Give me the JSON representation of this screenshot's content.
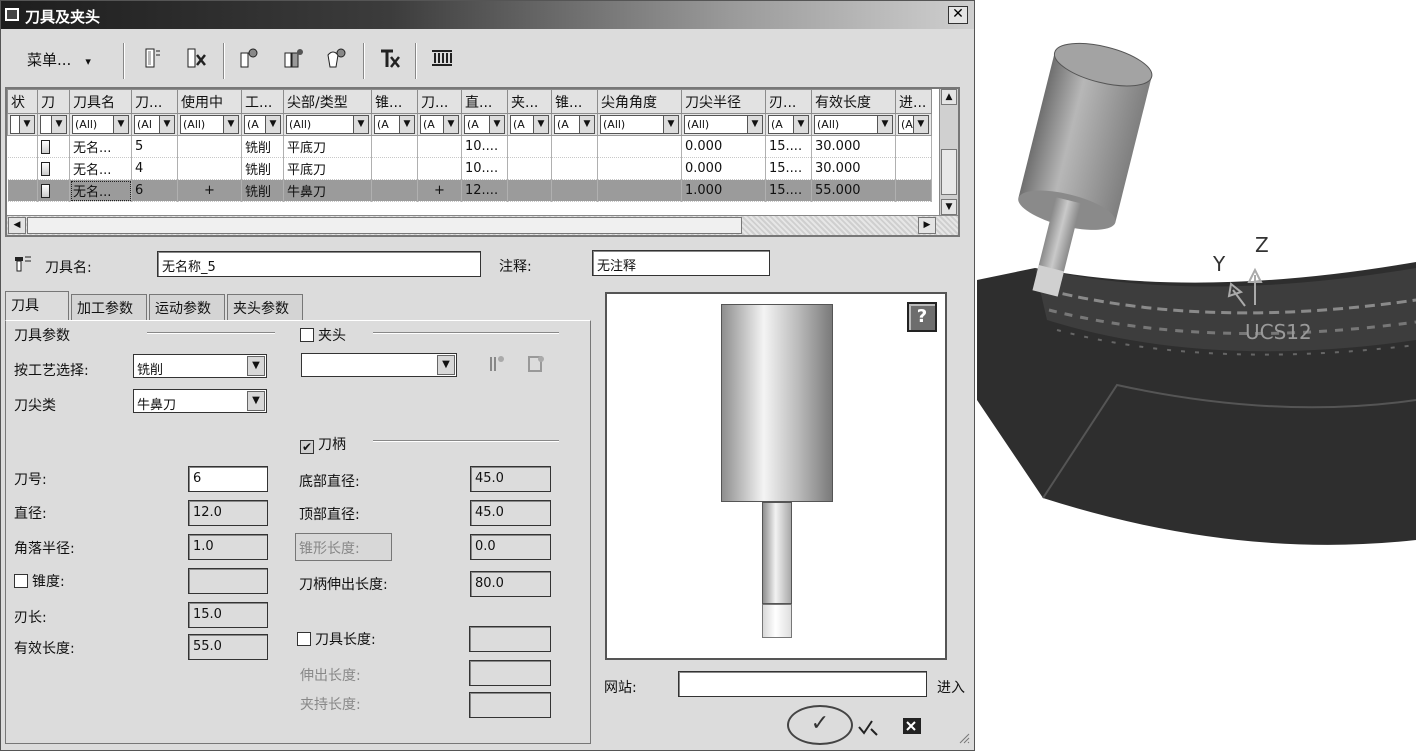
{
  "window": {
    "title": "刀具及夹头",
    "close_label": "✕"
  },
  "toolbar": {
    "menu_label": "菜单...",
    "menu_arrow": "▾",
    "icons": [
      "tool-new-icon",
      "tool-delete-icon",
      "tool-add-icon",
      "tool-copy-icon",
      "tool-edit-icon",
      "tool-remove-icon",
      "tool-library-icon"
    ]
  },
  "grid": {
    "columns": [
      "状",
      "刀",
      "刀具名",
      "刀...",
      "使用中",
      "工...",
      "尖部/类型",
      "锥...",
      "刀...",
      "直...",
      "夹...",
      "锥...",
      "尖角角度",
      "刀尖半径",
      "刃...",
      "有效长度",
      "进..."
    ],
    "filters": [
      "",
      "",
      "(All)",
      "(Al",
      "(All)",
      "(A",
      "(All)",
      "(A",
      "(A",
      "(A",
      "(A",
      "(A",
      "(All)",
      "(All)",
      "(A",
      "(All)",
      "(A"
    ],
    "rows": [
      [
        "",
        "",
        "无名...",
        "5",
        "",
        "铣削",
        "平底刀",
        "",
        "",
        "10....",
        "",
        "",
        "",
        "0.000",
        "15....",
        "30.000",
        ""
      ],
      [
        "",
        "",
        "无名...",
        "4",
        "",
        "铣削",
        "平底刀",
        "",
        "",
        "10....",
        "",
        "",
        "",
        "0.000",
        "15....",
        "30.000",
        ""
      ],
      [
        "",
        "",
        "无名...",
        "6",
        "+",
        "铣削",
        "牛鼻刀",
        "",
        "+",
        "12....",
        "",
        "",
        "",
        "1.000",
        "15....",
        "55.000",
        ""
      ]
    ]
  },
  "header": {
    "tool_name_label": "刀具名:",
    "tool_name_value": "无名称_5",
    "comment_label": "注释:",
    "comment_value": "无注释"
  },
  "tabs": [
    "刀具",
    "加工参数",
    "运动参数",
    "夹头参数"
  ],
  "tool_params": {
    "section_label": "刀具参数",
    "process_label": "按工艺选择:",
    "process_value": "铣削",
    "tip_type_label": "刀尖类",
    "tip_type_value": "牛鼻刀",
    "number_label": "刀号:",
    "number_value": "6",
    "diameter_label": "直径:",
    "diameter_value": "12.0",
    "corner_radius_label": "角落半径:",
    "corner_radius_value": "1.0",
    "taper_label": "锥度:",
    "taper_value": "",
    "flute_length_label": "刃长:",
    "flute_length_value": "15.0",
    "effective_length_label": "有效长度:",
    "effective_length_value": "55.0"
  },
  "holder": {
    "chuck_label": "夹头",
    "chuck_value": "",
    "shank_label": "刀柄",
    "bottom_diameter_label": "底部直径:",
    "bottom_diameter_value": "45.0",
    "top_diameter_label": "顶部直径:",
    "top_diameter_value": "45.0",
    "cone_length_label": "锥形长度:",
    "cone_length_value": "0.0",
    "shank_extension_label": "刀柄伸出长度:",
    "shank_extension_value": "80.0",
    "tool_length_label": "刀具长度:",
    "tool_length_value": "",
    "extension_label": "伸出长度:",
    "extension_value": "",
    "clamp_length_label": "夹持长度:",
    "clamp_length_value": ""
  },
  "preview": {
    "help_label": "?"
  },
  "footer": {
    "website_label": "网站:",
    "website_value": "",
    "go_label": "进入",
    "ok_label": "✓"
  },
  "viewport": {
    "axis_y": "Y",
    "axis_z": "Z",
    "ucs_label": "UCS12"
  },
  "colors": {
    "dialog_bg": "#dcdcdc",
    "selected_row": "#9b9b9b",
    "part_dark": "#333333"
  }
}
